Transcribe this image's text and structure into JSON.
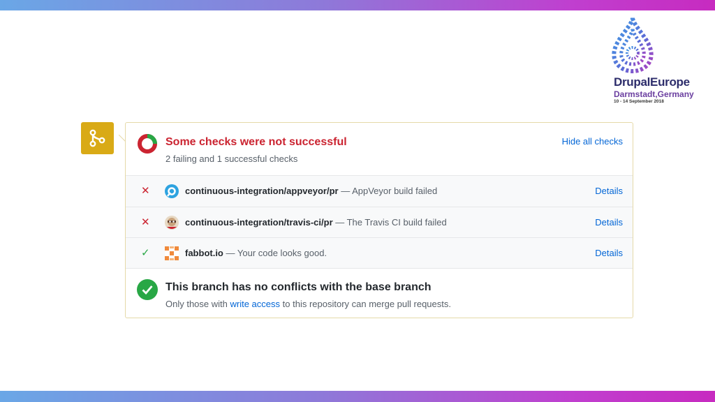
{
  "logo": {
    "name": "DrupalEurope",
    "location": "Darmstadt,Germany",
    "dates": "10 - 14 September 2018"
  },
  "checks_panel": {
    "title": "Some checks were not successful",
    "subtitle": "2 failing and 1 successful checks",
    "hide_label": "Hide all checks",
    "checks": [
      {
        "status": "failed",
        "name": "continuous-integration/appveyor/pr",
        "description": " — AppVeyor build failed",
        "details_label": "Details",
        "avatar": "appveyor-icon"
      },
      {
        "status": "failed",
        "name": "continuous-integration/travis-ci/pr",
        "description": " — The Travis CI build failed",
        "details_label": "Details",
        "avatar": "travis-ci-icon"
      },
      {
        "status": "success",
        "name": "fabbot.io",
        "description": " — Your code looks good.",
        "details_label": "Details",
        "avatar": "fabbot-icon"
      }
    ]
  },
  "merge_status": {
    "title": "This branch has no conflicts with the base branch",
    "sub_prefix": "Only those with ",
    "sub_link": "write access",
    "sub_suffix": " to this repository can merge pull requests."
  },
  "colors": {
    "fail": "#cb2431",
    "success": "#28a745",
    "link": "#0366d6",
    "merge_badge": "#d9aa16"
  }
}
